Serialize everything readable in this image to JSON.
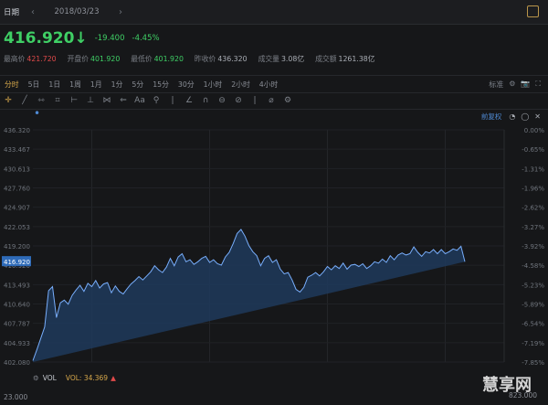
{
  "topbar": {
    "label": "日期",
    "prev": "‹",
    "date": "2018/03/23",
    "next": "›"
  },
  "quote": {
    "price": "416.920",
    "arrow": "↓",
    "change": "-19.400",
    "change_pct": "-4.45%"
  },
  "stats": [
    {
      "k": "最高价",
      "v": "421.720",
      "tone": "up"
    },
    {
      "k": "开盘价",
      "v": "401.920",
      "tone": "down"
    },
    {
      "k": "最低价",
      "v": "401.920",
      "tone": "down"
    },
    {
      "k": "昨收价",
      "v": "436.320",
      "tone": "neu"
    },
    {
      "k": "成交量",
      "v": "3.08亿",
      "tone": "neu"
    },
    {
      "k": "成交额",
      "v": "1261.38亿",
      "tone": "neu"
    }
  ],
  "tabs": [
    "分时",
    "5日",
    "1日",
    "1周",
    "1月",
    "1分",
    "5分",
    "15分",
    "30分",
    "1小时",
    "2小时",
    "4小时"
  ],
  "tab_active_index": 0,
  "tabs_right": [
    "标准",
    "⚙",
    "📷",
    "⛶"
  ],
  "tools": [
    "✛",
    "╱",
    "⇿",
    "⌗",
    "⊢",
    "⊥",
    "⋈",
    "⇐",
    "Aa",
    "⚲",
    "|",
    "∠",
    "∩",
    "⊖",
    "⊘",
    "|",
    "⌀",
    "⚙"
  ],
  "tool_active_index": 0,
  "chart_header": {
    "name": "前复权",
    "icons": [
      "◔",
      "◯",
      "✕"
    ]
  },
  "chart_data": {
    "type": "area",
    "ylim": [
      402.0,
      436.5
    ],
    "y_ticks_left": [
      "436.320",
      "433.467",
      "430.613",
      "427.760",
      "424.907",
      "422.053",
      "419.200",
      "416.920",
      "413.493",
      "410.640",
      "407.787",
      "404.933",
      "402.080"
    ],
    "y_ticks_right": [
      "0.00%",
      "-0.65%",
      "-1.31%",
      "-1.96%",
      "-2.62%",
      "-3.27%",
      "-3.92%",
      "-4.58%",
      "-5.23%",
      "-5.89%",
      "-6.54%",
      "-7.19%",
      "-7.85%"
    ],
    "current_tag": "416.920",
    "x": [
      0,
      2,
      4,
      6,
      8,
      10,
      12,
      14,
      16,
      18,
      20,
      22,
      24,
      26,
      28,
      30,
      32,
      34,
      36,
      38,
      40,
      42,
      44,
      46,
      48,
      50,
      52,
      54,
      56,
      58,
      60,
      62,
      64,
      66,
      68,
      70,
      72,
      74,
      76,
      78,
      80,
      82,
      84,
      86,
      88,
      90,
      92,
      94,
      96,
      98,
      100,
      102,
      104,
      106,
      108,
      110,
      112,
      114,
      116,
      118,
      120,
      122,
      124,
      126,
      128,
      130,
      132,
      134,
      136,
      138,
      140,
      142,
      144,
      146,
      148,
      150,
      152,
      154,
      156,
      158,
      160,
      162,
      164,
      166,
      168,
      170,
      172,
      174,
      176,
      178,
      180,
      182,
      184,
      186,
      188,
      190,
      192,
      194,
      196,
      198,
      200,
      202,
      204,
      206,
      208,
      210,
      212,
      214,
      216,
      218,
      220,
      222,
      224,
      226,
      228,
      230,
      232,
      234,
      236,
      238,
      240
    ],
    "values": [
      402.2,
      403.8,
      405.5,
      407.2,
      412.6,
      413.2,
      408.6,
      410.8,
      411.2,
      410.6,
      411.9,
      412.7,
      413.4,
      412.5,
      413.7,
      413.2,
      414.1,
      413.0,
      413.6,
      413.8,
      412.3,
      413.3,
      412.5,
      412.1,
      412.9,
      413.6,
      414.1,
      414.7,
      414.2,
      414.8,
      415.4,
      416.3,
      415.7,
      415.3,
      416.1,
      417.4,
      416.3,
      417.6,
      418.1,
      416.9,
      417.2,
      416.5,
      416.9,
      417.4,
      417.7,
      416.8,
      417.2,
      416.6,
      416.4,
      417.6,
      418.3,
      419.6,
      421.1,
      421.7,
      420.7,
      419.3,
      418.4,
      417.8,
      416.3,
      417.4,
      417.8,
      416.8,
      417.2,
      415.8,
      415.1,
      415.3,
      414.2,
      412.8,
      412.4,
      413.1,
      414.6,
      414.9,
      415.3,
      414.8,
      415.4,
      416.2,
      415.7,
      416.3,
      415.9,
      416.7,
      415.8,
      416.4,
      416.5,
      416.2,
      416.6,
      415.9,
      416.3,
      416.9,
      416.7,
      417.3,
      416.8,
      417.8,
      417.2,
      417.9,
      418.2,
      417.9,
      418.1,
      419.1,
      418.3,
      417.7,
      418.4,
      418.2,
      418.7,
      418.1,
      418.7,
      418.1,
      418.4,
      418.8,
      418.6,
      419.2,
      416.9
    ],
    "line_color": "#78aefc",
    "fill_color": "#1e3a5c"
  },
  "volume": {
    "gear": "⚙",
    "label": "VOL",
    "value": "VOL: 34.369",
    "arrow": "▲"
  },
  "bottom": {
    "left": "23.000",
    "right": "823.000"
  },
  "watermark": "慧享网"
}
